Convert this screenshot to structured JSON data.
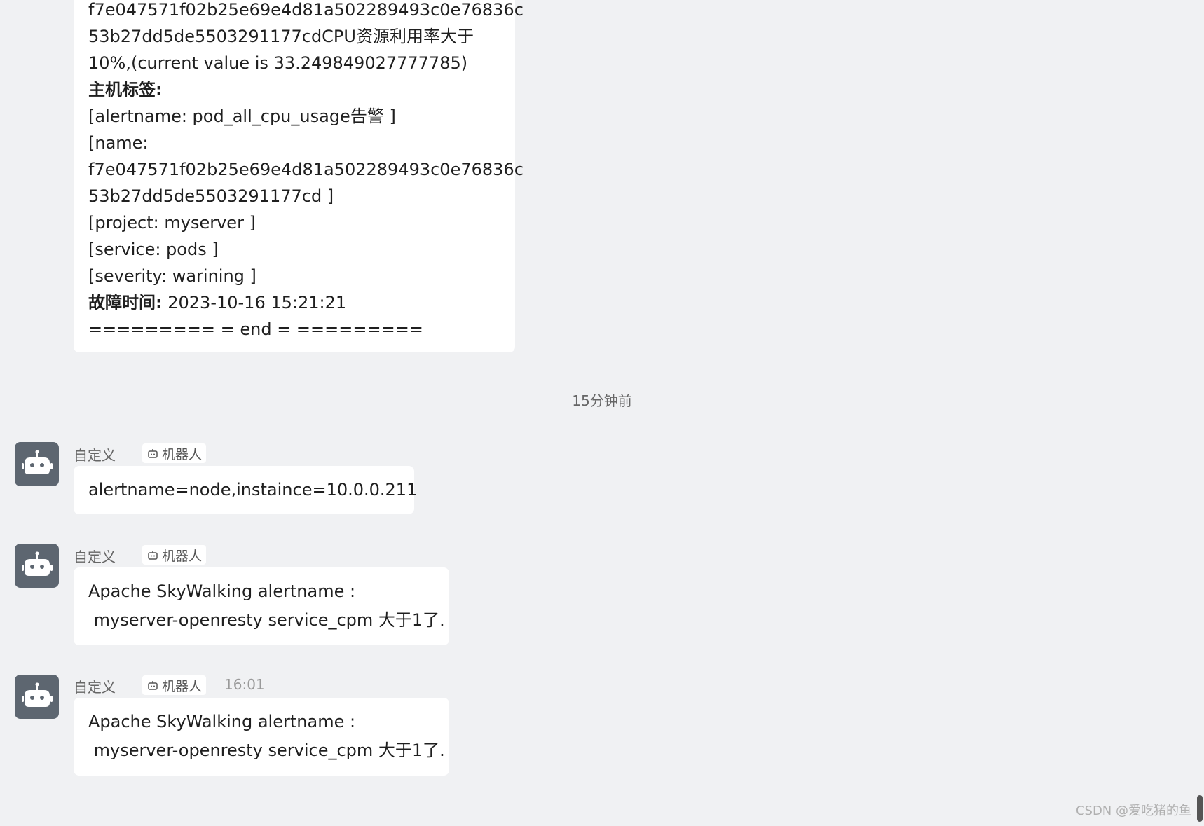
{
  "first_message": {
    "lines": [
      {
        "text": "f7e047571f02b25e69e4d81a502289493c0e76836c"
      },
      {
        "text": "53b27dd5de5503291177cdCPU资源利用率大于"
      },
      {
        "text": "10%,(current value is 33.249849027777785)"
      },
      {
        "label": "主机标签:"
      },
      {
        "text": "[alertname: pod_all_cpu_usage告警 ]"
      },
      {
        "text": "[name:"
      },
      {
        "text": "f7e047571f02b25e69e4d81a502289493c0e76836c"
      },
      {
        "text": "53b27dd5de5503291177cd ]"
      },
      {
        "text": "[project: myserver ]"
      },
      {
        "text": "[service: pods ]"
      },
      {
        "text": "[severity: warining ]"
      },
      {
        "label": "故障时间:",
        "text": " 2023-10-16 15:21:21"
      },
      {
        "text": "========= = end = ========="
      }
    ]
  },
  "time_separator": "15分钟前",
  "messages": [
    {
      "sender": "自定义",
      "tag": "机器人",
      "time": "",
      "lines": [
        "alertname=node,instaince=10.0.0.211"
      ]
    },
    {
      "sender": "自定义",
      "tag": "机器人",
      "time": "",
      "lines": [
        "Apache SkyWalking alertname :",
        " myserver-openresty service_cpm 大于1了."
      ]
    },
    {
      "sender": "自定义",
      "tag": "机器人",
      "time": "16:01",
      "lines": [
        "Apache SkyWalking alertname :",
        " myserver-openresty service_cpm 大于1了."
      ]
    }
  ],
  "watermark": "CSDN @爱吃猪的鱼",
  "colors": {
    "background": "#f0f1f3",
    "bubble": "#ffffff",
    "avatar": "#5d6670"
  },
  "icons": {
    "avatar": "robot-avatar-icon",
    "tag": "robot-icon"
  }
}
